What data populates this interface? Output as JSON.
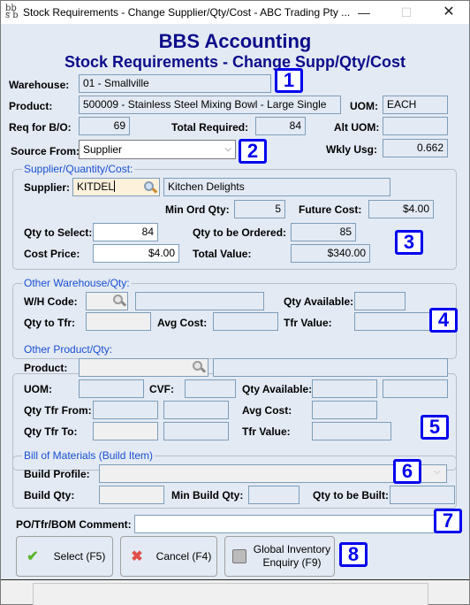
{
  "window": {
    "title": "Stock Requirements - Change Supplier/Qty/Cost - ABC Trading Pty ...",
    "app_icon": "bbs-logo-icon",
    "minimize_glyph": "—",
    "maximize_glyph": "☐",
    "close_glyph": "✕"
  },
  "header": {
    "company": "BBS Accounting",
    "subtitle": "Stock Requirements - Change Supp/Qty/Cost"
  },
  "top": {
    "warehouse_label": "Warehouse:",
    "warehouse_value": "01 - Smallville",
    "product_label": "Product:",
    "product_value": "500009 - Stainless Steel Mixing Bowl - Large Single",
    "uom_label": "UOM:",
    "uom_value": "EACH",
    "req_bo_label": "Req for B/O:",
    "req_bo_value": "69",
    "total_required_label": "Total Required:",
    "total_required_value": "84",
    "alt_uom_label": "Alt UOM:",
    "alt_uom_value": "",
    "source_from_label": "Source From:",
    "source_from_value": "Supplier",
    "wkly_usg_label": "Wkly Usg:",
    "wkly_usg_value": "0.662"
  },
  "supplier_group": {
    "title": "Supplier/Quantity/Cost:",
    "supplier_label": "Supplier:",
    "supplier_code": "KITDEL",
    "supplier_name": "Kitchen Delights",
    "min_ord_qty_label": "Min Ord Qty:",
    "min_ord_qty_value": "5",
    "future_cost_label": "Future Cost:",
    "future_cost_value": "$4.00",
    "qty_to_select_label": "Qty to Select:",
    "qty_to_select_value": "84",
    "qty_to_be_ordered_label": "Qty to be Ordered:",
    "qty_to_be_ordered_value": "85",
    "cost_price_label": "Cost Price:",
    "cost_price_value": "$4.00",
    "total_value_label": "Total Value:",
    "total_value_value": "$340.00"
  },
  "other_warehouse_group": {
    "title": "Other Warehouse/Qty:",
    "wh_code_label": "W/H Code:",
    "wh_code_value": "",
    "wh_name_value": "",
    "qty_available_label": "Qty Available:",
    "qty_available_value": "",
    "qty_to_tfr_label": "Qty to Tfr:",
    "qty_to_tfr_value": "",
    "avg_cost_label": "Avg Cost:",
    "avg_cost_value": "",
    "tfr_value_label": "Tfr Value:",
    "tfr_value_value": ""
  },
  "other_product_group": {
    "title": "Other Product/Qty:",
    "product_label": "Product:",
    "product_code": "",
    "product_desc": "",
    "uom_label": "UOM:",
    "uom_value": "",
    "cvf_label": "CVF:",
    "cvf_value": "",
    "qty_available_label": "Qty Available:",
    "qty_available_value1": "",
    "qty_available_value2": "",
    "qty_tfr_from_label": "Qty Tfr From:",
    "qty_tfr_from_value1": "",
    "qty_tfr_from_value2": "",
    "avg_cost_label": "Avg Cost:",
    "avg_cost_value": "",
    "qty_tfr_to_label": "Qty Tfr To:",
    "qty_tfr_to_value1": "",
    "qty_tfr_to_value2": "",
    "tfr_value_label": "Tfr Value:",
    "tfr_value_value": ""
  },
  "bom_group": {
    "title": "Bill of Materials (Build Item)",
    "build_profile_label": "Build Profile:",
    "build_profile_value": "",
    "build_qty_label": "Build Qty:",
    "build_qty_value": "",
    "min_build_qty_label": "Min Build Qty:",
    "min_build_qty_value": "",
    "qty_to_be_built_label": "Qty to be Built:",
    "qty_to_be_built_value": ""
  },
  "comment": {
    "label": "PO/Tfr/BOM Comment:",
    "value": ""
  },
  "buttons": {
    "select": "Select (F5)",
    "cancel": "Cancel (F4)",
    "global_line1": "Global Inventory",
    "global_line2": "Enquiry (F9)"
  },
  "badges": [
    "1",
    "2",
    "3",
    "4",
    "5",
    "6",
    "7",
    "8"
  ],
  "colors": {
    "header_text": "#0d0d8a",
    "group_title": "#1a4fd0",
    "badge_border": "#0000ee",
    "background": "#e3eaf4"
  }
}
